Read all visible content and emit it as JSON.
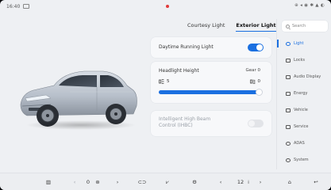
{
  "status": {
    "time": "16:40"
  },
  "tabs": [
    {
      "label": "Courtesy Light",
      "active": false
    },
    {
      "label": "Exterior Light",
      "active": true
    }
  ],
  "daytime_running_light": {
    "label": "Daytime Running Light",
    "on": true
  },
  "headlight_height": {
    "label": "Headlight Height",
    "gear_text": "Gear 0",
    "min_label": "5",
    "max_label": "0",
    "level": 1.0
  },
  "high_beam_control": {
    "label": "Intelligent High Beam Control (IHBC)",
    "on": false
  },
  "sidebar": {
    "search_placeholder": "Search",
    "items": [
      {
        "label": "Light",
        "icon": "bulb-icon",
        "active": true
      },
      {
        "label": "Locks",
        "icon": "lock-icon",
        "active": false
      },
      {
        "label": "Audio Display",
        "icon": "display-icon",
        "active": false
      },
      {
        "label": "Energy",
        "icon": "battery-icon",
        "active": false
      },
      {
        "label": "Vehicle",
        "icon": "car-icon",
        "active": false
      },
      {
        "label": "Service",
        "icon": "wrench-icon",
        "active": false
      },
      {
        "label": "ADAS",
        "icon": "steering-icon",
        "active": false
      },
      {
        "label": "System",
        "icon": "gear-icon",
        "active": false
      }
    ]
  },
  "dock": {
    "fan_speed": "0",
    "temperature": "12",
    "left_chevron": "‹",
    "right_chevron": "›"
  },
  "colors": {
    "accent": "#1a6fe0",
    "background": "#eef0f3",
    "card": "#f7f8fa"
  }
}
